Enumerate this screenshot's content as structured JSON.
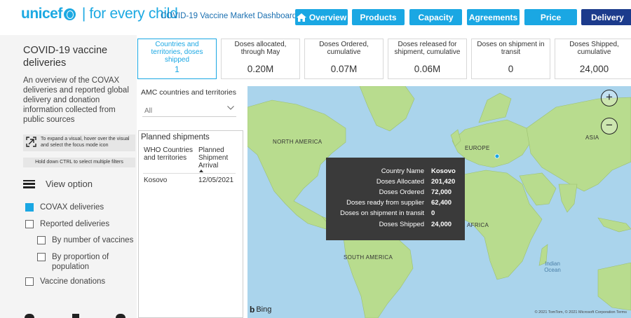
{
  "header": {
    "logo_brand": "unicef",
    "logo_tag": "for every child",
    "dashboard_title": "COVID-19 Vaccine Market Dashboard",
    "nav": [
      {
        "label": "Overview",
        "active": false,
        "home": true
      },
      {
        "label": "Products",
        "active": false
      },
      {
        "label": "Capacity",
        "active": false
      },
      {
        "label": "Agreements",
        "active": false
      },
      {
        "label": "Price",
        "active": false
      },
      {
        "label": "Delivery",
        "active": true
      }
    ]
  },
  "left_panel": {
    "title": "COVID-19 vaccine deliveries",
    "description": "An overview of the COVAX deliveries and reported global delivery and donation information collected from public sources",
    "hint_expand": "To expand a visual, hover over the visual and select the focus mode icon",
    "hint_ctrl": "Hold down CTRL to select multiple filters",
    "view_option": "View option",
    "options": [
      {
        "label": "COVAX deliveries",
        "checked": true
      },
      {
        "label": "Reported deliveries",
        "checked": false
      },
      {
        "label": "By number of vaccines",
        "checked": false
      },
      {
        "label": "By proportion of population",
        "checked": false
      },
      {
        "label": "Vaccine donations",
        "checked": false
      }
    ]
  },
  "kpis": [
    {
      "label": "Countries and territories, doses shipped",
      "value": "1",
      "selected": true
    },
    {
      "label": "Doses allocated, through May",
      "value": "0.20M"
    },
    {
      "label": "Doses Ordered, cumulative",
      "value": "0.07M"
    },
    {
      "label": "Doses released for shipment, cumulative",
      "value": "0.06M"
    },
    {
      "label": "Doses on shipment in transit",
      "value": "0"
    },
    {
      "label": "Doses Shipped, cumulative",
      "value": "24,000"
    }
  ],
  "filter": {
    "label": "AMC countries and territories",
    "value": "All"
  },
  "planned_shipments": {
    "title": "Planned shipments",
    "col1": "WHO Countries and territories",
    "col2": "Planned Shipment Arrival",
    "rows": [
      {
        "country": "Kosovo",
        "date": "12/05/2021"
      }
    ]
  },
  "map": {
    "labels": {
      "north_america": "NORTH AMERICA",
      "europe": "EUROPE",
      "asia": "ASIA",
      "africa": "AFRICA",
      "south_america": "SOUTH AMERICA",
      "indian_ocean": "Indian Ocean"
    },
    "zoom_in": "+",
    "zoom_out": "−",
    "attribution_brand": "Bing",
    "copyright": "© 2021 TomTom, © 2021 Microsoft Corporation  Terms"
  },
  "tooltip": {
    "rows": [
      {
        "key": "Country Name",
        "value": "Kosovo"
      },
      {
        "key": "Doses Allocated",
        "value": "201,420"
      },
      {
        "key": "Doses Ordered",
        "value": "72,000"
      },
      {
        "key": "Doses ready from supplier",
        "value": "62,400"
      },
      {
        "key": "Doses on shipment in transit",
        "value": "0"
      },
      {
        "key": "Doses Shipped",
        "value": "24,000"
      }
    ]
  },
  "colors": {
    "brand": "#1ca9e2",
    "nav_bg": "#1aa7e3",
    "nav_active": "#1c3b8c",
    "land": "#b8dc8e",
    "water": "#aad4ec",
    "tooltip_bg": "#3a3a3a"
  }
}
